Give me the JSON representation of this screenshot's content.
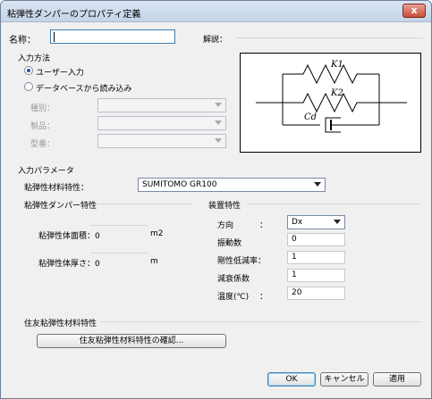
{
  "window": {
    "title": "粘弾性ダンパーのプロパティ定義",
    "close_label": "x"
  },
  "name": {
    "label": "名称：",
    "value": "",
    "explanation_label": "解説："
  },
  "input_method": {
    "title": "入力方法",
    "options": [
      {
        "label": "ユーザー入力",
        "selected": true
      },
      {
        "label": "データベースから読み込み",
        "selected": false
      }
    ],
    "fields": [
      {
        "label": "種別："
      },
      {
        "label": "製品："
      },
      {
        "label": "型番："
      }
    ]
  },
  "diagram": {
    "k1": "K1",
    "k2": "K2",
    "cd": "Cd"
  },
  "input_params": {
    "title": "入力パラメータ",
    "material_label": "粘弾性材料特性：",
    "material_value": "SUMITOMO GR100"
  },
  "damper_props": {
    "title": "粘弾性ダンパー特性",
    "area_label": "粘弾性体面積：0",
    "area_unit": "m2",
    "thickness_label": "粘弾性体厚さ：0",
    "thickness_unit": "m"
  },
  "device_props": {
    "title": "装置特性",
    "direction_label": "方向",
    "colon": "：",
    "direction_value": "Dx",
    "count_label": "振動数",
    "count_value": "0",
    "stiffness_label": "剛性低減率：",
    "stiffness_value": "1",
    "damping_label": "減衰係数",
    "damping_value": "1",
    "temp_label": "温度(℃)",
    "temp_value": "20"
  },
  "sumitomo": {
    "title": "住友粘弾性材料特性",
    "confirm_label": "住友粘弾性材料特性の確認..."
  },
  "footer": {
    "ok": "OK",
    "cancel": "キャンセル",
    "apply": "適用"
  }
}
